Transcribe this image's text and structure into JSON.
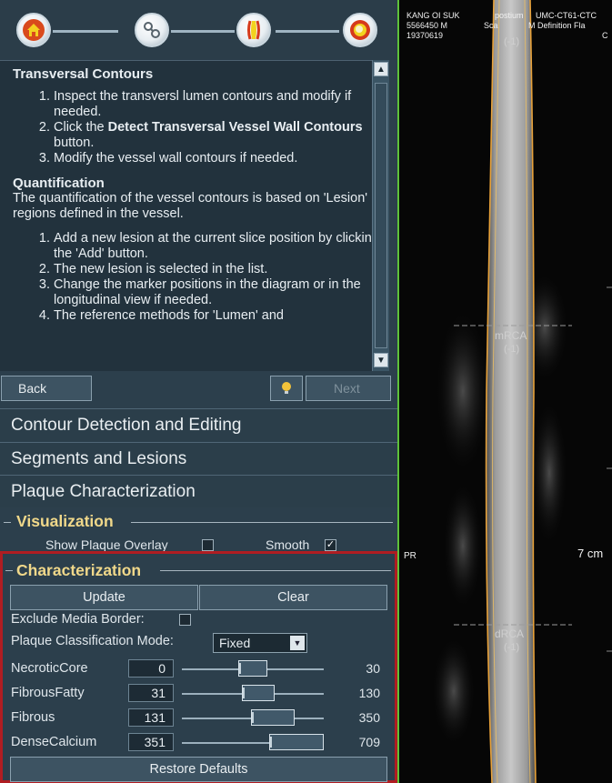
{
  "workflow": {
    "steps": [
      {
        "icon": "home-icon"
      },
      {
        "icon": "vessel-path-icon"
      },
      {
        "icon": "vessel-contour-icon"
      },
      {
        "icon": "cross-section-icon"
      }
    ]
  },
  "instructions": {
    "section1_title": "Transversal Contours",
    "section1_items": [
      "Inspect the transversl lumen contours and modify if needed.",
      "Click the ",
      "Detect Transversal Vessel Wall Contours",
      " button.",
      "Modify the vessel wall contours if needed."
    ],
    "section2_title": "Quantification",
    "section2_text": "The quantification of the vessel contours is based on 'Lesion' regions defined in the vessel.",
    "section2_items": [
      "Add a new lesion at the current slice position by clicking the 'Add' button.",
      "The new lesion is selected in the list.",
      "Change the marker positions in the diagram or in the longitudinal view if needed.",
      "The reference methods for 'Lumen' and"
    ]
  },
  "nav": {
    "back": "Back",
    "next": "Next"
  },
  "sections": {
    "contour": "Contour Detection and Editing",
    "segments": "Segments and Lesions",
    "plaque": "Plaque Characterization"
  },
  "visualization": {
    "title": "Visualization",
    "show_overlay": "Show Plaque Overlay",
    "show_overlay_checked": false,
    "smooth": "Smooth",
    "smooth_checked": true
  },
  "characterization": {
    "title": "Characterization",
    "update": "Update",
    "clear": "Clear",
    "exclude_media": "Exclude Media Border:",
    "exclude_media_checked": false,
    "mode_label": "Plaque Classification Mode:",
    "mode_value": "Fixed",
    "rows": [
      {
        "label": "NecroticCore",
        "min": "0",
        "max": "30"
      },
      {
        "label": "FibrousFatty",
        "min": "31",
        "max": "130"
      },
      {
        "label": "Fibrous",
        "min": "131",
        "max": "350"
      },
      {
        "label": "DenseCalcium",
        "min": "351",
        "max": "709"
      }
    ],
    "restore": "Restore Defaults"
  },
  "viewer": {
    "patient_line1": "KANG OI SUK",
    "patient_line2": "5566450 M",
    "patient_line3": "19370619",
    "series_line1": "postium",
    "series_line2": "UMC-CT61-CTC",
    "series_line3": "Sca",
    "series_line4": "M Definition Fla",
    "series_line5": "C",
    "top_label": "(-1)",
    "mid_label": "mRCA",
    "mid_sub": "(-1)",
    "low_label": "dRCA",
    "low_sub": "(-1)",
    "pr": "PR",
    "scale": "7 cm",
    "border_color": "#5ec23a",
    "contour_color": "#e8a23a"
  }
}
